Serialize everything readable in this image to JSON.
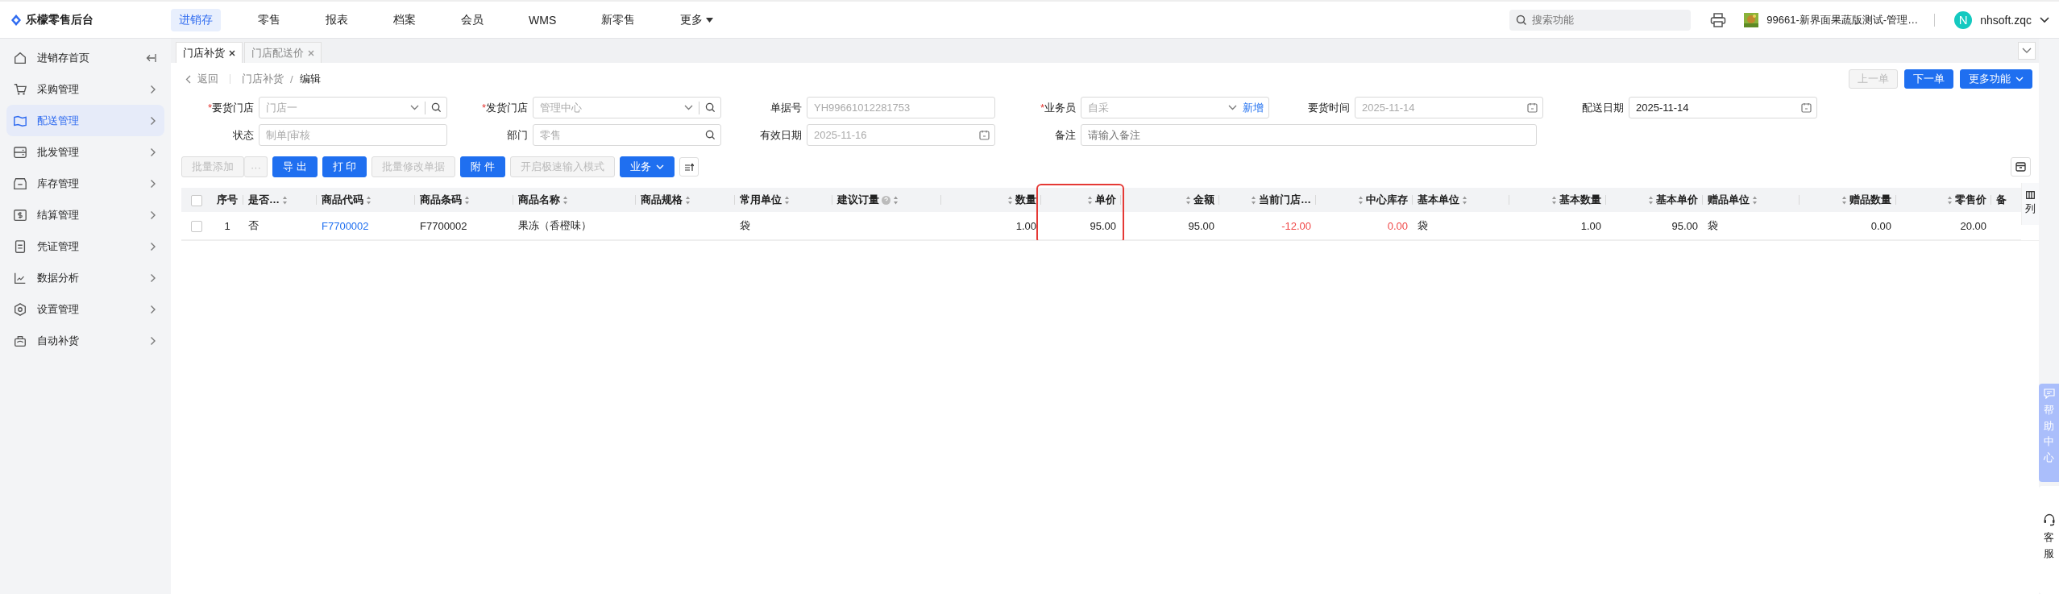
{
  "brand": {
    "name": "乐檬零售后台"
  },
  "top_nav": [
    {
      "label": "进销存",
      "selected": true,
      "dropdown": false
    },
    {
      "label": "零售",
      "selected": false,
      "dropdown": false
    },
    {
      "label": "报表",
      "selected": false,
      "dropdown": false
    },
    {
      "label": "档案",
      "selected": false,
      "dropdown": false
    },
    {
      "label": "会员",
      "selected": false,
      "dropdown": false
    },
    {
      "label": "WMS",
      "selected": false,
      "dropdown": false
    },
    {
      "label": "新零售",
      "selected": false,
      "dropdown": false
    },
    {
      "label": "更多",
      "selected": false,
      "dropdown": true
    }
  ],
  "search": {
    "placeholder": "搜索功能"
  },
  "store": {
    "name": "99661-新界面果蔬版测试-管理…"
  },
  "user": {
    "initial": "N",
    "name": "nhsoft.zqc"
  },
  "sidebar": {
    "items": [
      {
        "label": "进销存首页",
        "selected": false
      },
      {
        "label": "采购管理",
        "selected": false
      },
      {
        "label": "配送管理",
        "selected": true
      },
      {
        "label": "批发管理",
        "selected": false
      },
      {
        "label": "库存管理",
        "selected": false
      },
      {
        "label": "结算管理",
        "selected": false
      },
      {
        "label": "凭证管理",
        "selected": false
      },
      {
        "label": "数据分析",
        "selected": false
      },
      {
        "label": "设置管理",
        "selected": false
      },
      {
        "label": "自动补货",
        "selected": false
      }
    ]
  },
  "tabs": [
    {
      "label": "门店补货",
      "selected": true
    },
    {
      "label": "门店配送价",
      "selected": false
    }
  ],
  "breadcrumb": {
    "back": "返回",
    "separator": "/",
    "items": [
      "门店补货",
      "编辑"
    ]
  },
  "nav_buttons": [
    {
      "label": "上一单",
      "disabled": true,
      "dropdown": false
    },
    {
      "label": "下一单",
      "disabled": false,
      "dropdown": false
    },
    {
      "label": "更多功能",
      "disabled": false,
      "dropdown": true
    }
  ],
  "form": {
    "required_mark": "*",
    "fields": [
      {
        "label": "要货门店",
        "required": true,
        "kind": "select-search",
        "value": "门店一",
        "disabled": true
      },
      {
        "label": "发货门店",
        "required": true,
        "kind": "select-search",
        "value": "管理中心",
        "disabled": true
      },
      {
        "label": "单据号",
        "required": false,
        "kind": "text",
        "value": "YH99661012281753",
        "disabled": true
      },
      {
        "label": "业务员",
        "required": true,
        "kind": "select-add",
        "value": "自采",
        "action": "新增",
        "disabled": true
      },
      {
        "label": "要货时间",
        "required": false,
        "kind": "date",
        "value": "2025-11-14",
        "disabled": true
      },
      {
        "label": "配送日期",
        "required": false,
        "kind": "date",
        "value": "2025-11-14",
        "disabled": false
      },
      {
        "label": "状态",
        "required": false,
        "kind": "text",
        "value": "制单|审核",
        "disabled": true
      },
      {
        "label": "部门",
        "required": false,
        "kind": "search",
        "value": "零售",
        "disabled": true
      },
      {
        "label": "有效日期",
        "required": false,
        "kind": "date",
        "value": "2025-11-16",
        "disabled": true
      },
      {
        "label": "备注",
        "required": false,
        "kind": "note",
        "placeholder": "请输入备注"
      }
    ]
  },
  "toolbar": [
    {
      "kind": "button",
      "label": "批量添加",
      "disabled": true
    },
    {
      "kind": "more",
      "label": "···",
      "disabled": true
    },
    {
      "kind": "button",
      "label": "导 出",
      "disabled": false
    },
    {
      "kind": "button",
      "label": "打 印",
      "disabled": false
    },
    {
      "kind": "button",
      "label": "批量修改单据",
      "disabled": true
    },
    {
      "kind": "button",
      "label": "附 件",
      "disabled": false
    },
    {
      "kind": "button",
      "label": "开启极速输入模式",
      "disabled": true
    },
    {
      "kind": "dropdown",
      "label": "业务",
      "disabled": false
    },
    {
      "kind": "icon"
    }
  ],
  "table": {
    "select_all": {
      "checked": false
    },
    "columns": [
      {
        "kind": "index",
        "label": "序号",
        "sortable": false,
        "help": false,
        "highlighted": false
      },
      {
        "kind": "text",
        "label": "是否…",
        "sortable": true,
        "help": false,
        "highlighted": false
      },
      {
        "kind": "text",
        "label": "商品代码",
        "sortable": true,
        "help": false,
        "highlighted": false
      },
      {
        "kind": "text",
        "label": "商品条码",
        "sortable": true,
        "help": false,
        "highlighted": false
      },
      {
        "kind": "text",
        "label": "商品名称",
        "sortable": true,
        "help": false,
        "highlighted": false
      },
      {
        "kind": "text",
        "label": "商品规格",
        "sortable": true,
        "help": false,
        "highlighted": false
      },
      {
        "kind": "text",
        "label": "常用单位",
        "sortable": true,
        "help": false,
        "highlighted": false
      },
      {
        "kind": "text",
        "label": "建议订量",
        "sortable": true,
        "help": true,
        "highlighted": false
      },
      {
        "kind": "number",
        "label": "数量",
        "sortable": true,
        "help": false,
        "highlighted": false
      },
      {
        "kind": "number",
        "label": "单价",
        "sortable": true,
        "help": false,
        "highlighted": true
      },
      {
        "kind": "number",
        "label": "金额",
        "sortable": true,
        "help": false,
        "highlighted": false
      },
      {
        "kind": "number",
        "label": "当前门店…",
        "sortable": true,
        "help": false,
        "highlighted": false
      },
      {
        "kind": "number",
        "label": "中心库存",
        "sortable": true,
        "help": false,
        "highlighted": false
      },
      {
        "kind": "text",
        "label": "基本单位",
        "sortable": true,
        "help": false,
        "highlighted": false
      },
      {
        "kind": "number",
        "label": "基本数量",
        "sortable": true,
        "help": false,
        "highlighted": false
      },
      {
        "kind": "number",
        "label": "基本单价",
        "sortable": true,
        "help": false,
        "highlighted": false
      },
      {
        "kind": "text",
        "label": "赠品单位",
        "sortable": true,
        "help": false,
        "highlighted": false
      },
      {
        "kind": "number",
        "label": "赠品数量",
        "sortable": true,
        "help": false,
        "highlighted": false
      },
      {
        "kind": "number",
        "label": "零售价",
        "sortable": true,
        "help": false,
        "highlighted": false
      },
      {
        "kind": "text",
        "label": "备",
        "sortable": false,
        "help": false,
        "highlighted": false
      }
    ],
    "rows": [
      {
        "selected": false,
        "cells": [
          {
            "kind": "plain",
            "text": "1"
          },
          {
            "kind": "plain",
            "text": "否"
          },
          {
            "kind": "link",
            "text": "F7700002"
          },
          {
            "kind": "plain",
            "text": "F7700002"
          },
          {
            "kind": "plain",
            "text": "果冻（香橙味）"
          },
          {
            "kind": "plain",
            "text": ""
          },
          {
            "kind": "plain",
            "text": "袋"
          },
          {
            "kind": "plain",
            "text": ""
          },
          {
            "kind": "plain",
            "text": "1.00"
          },
          {
            "kind": "plain",
            "text": "95.00"
          },
          {
            "kind": "plain",
            "text": "95.00"
          },
          {
            "kind": "negative",
            "text": "-12.00"
          },
          {
            "kind": "negative",
            "text": "0.00"
          },
          {
            "kind": "plain",
            "text": "袋"
          },
          {
            "kind": "plain",
            "text": "1.00"
          },
          {
            "kind": "plain",
            "text": "95.00"
          },
          {
            "kind": "plain",
            "text": "袋"
          },
          {
            "kind": "plain",
            "text": "0.00"
          },
          {
            "kind": "plain",
            "text": "20.00"
          },
          {
            "kind": "plain",
            "text": ""
          }
        ]
      }
    ]
  },
  "column_settings": {
    "label": "列"
  },
  "help": {
    "label": "帮助中心"
  },
  "support": {
    "label": "客服"
  }
}
